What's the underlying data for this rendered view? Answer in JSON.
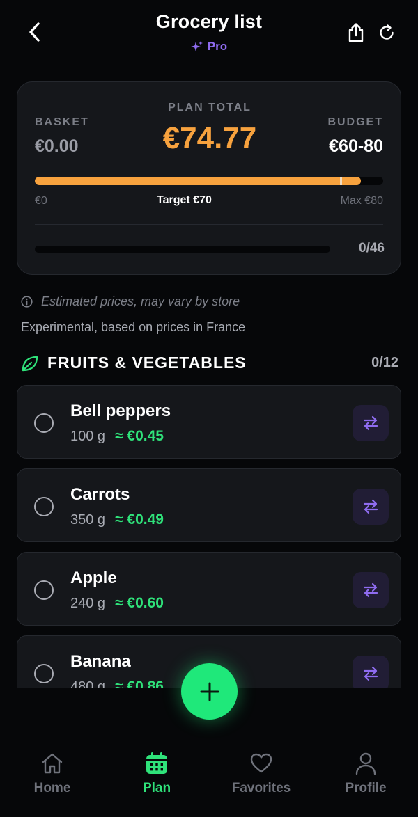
{
  "header": {
    "title": "Grocery list",
    "badge": "Pro"
  },
  "summary": {
    "basket_label": "BASKET",
    "basket_value": "€0.00",
    "plan_label": "PLAN TOTAL",
    "plan_value": "€74.77",
    "budget_label": "BUDGET",
    "budget_value": "€60-80",
    "bar_min": "€0",
    "bar_target": "Target €70",
    "bar_max": "Max €80",
    "progress_fraction": 0.935,
    "target_fraction": 0.875,
    "checked_count": "0/46",
    "checked_fraction": 0
  },
  "notes": {
    "estimate": "Estimated prices, may vary by store",
    "experimental": "Experimental, based on prices in France"
  },
  "section": {
    "title": "FRUITS & VEGETABLES",
    "count": "0/12"
  },
  "items": [
    {
      "name": "Bell peppers",
      "qty": "100 g",
      "price": "≈ €0.45"
    },
    {
      "name": "Carrots",
      "qty": "350 g",
      "price": "≈ €0.49"
    },
    {
      "name": "Apple",
      "qty": "240 g",
      "price": "≈ €0.60"
    },
    {
      "name": "Banana",
      "qty": "480 g",
      "price": "≈ €0.86"
    }
  ],
  "nav": {
    "home": "Home",
    "plan": "Plan",
    "favorites": "Favorites",
    "profile": "Profile"
  },
  "colors": {
    "accent_orange": "#f7a23e",
    "accent_green": "#2fe27a",
    "accent_purple": "#8f6cf0",
    "background": "#060709",
    "card": "#15171b"
  },
  "icons": {
    "back": "chevron-left-icon",
    "share": "share-icon",
    "refresh": "refresh-icon",
    "badge": "sparkles-icon",
    "info": "info-icon",
    "section": "leaf-icon",
    "swap": "swap-icon",
    "fab": "plus-icon"
  }
}
